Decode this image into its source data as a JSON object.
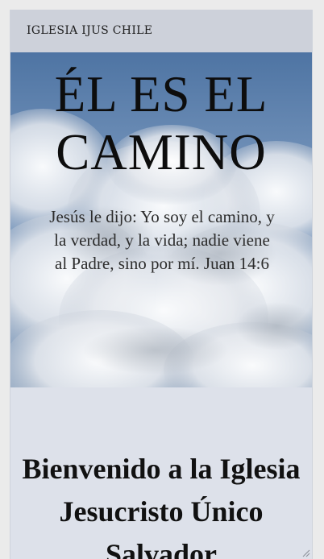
{
  "header": {
    "site_title": "IGLESIA IJUS CHILE"
  },
  "hero": {
    "title": "ÉL ES EL CAMINO",
    "verse": "Jesús le dijo: Yo soy el camino, y la verdad, y la vida; nadie viene al Padre, sino por mí. Juan 14:6"
  },
  "main": {
    "welcome_heading": "Bienvenido a la Iglesia Jesucristo Único Salvador"
  },
  "icons": {
    "resize": "resize-grip-icon"
  },
  "colors": {
    "page_background": "#ebebeb",
    "content_background": "#dde1ea",
    "header_background": "#cdd1da",
    "sky_blue": "#5f82ad",
    "text_dark": "#111111"
  }
}
